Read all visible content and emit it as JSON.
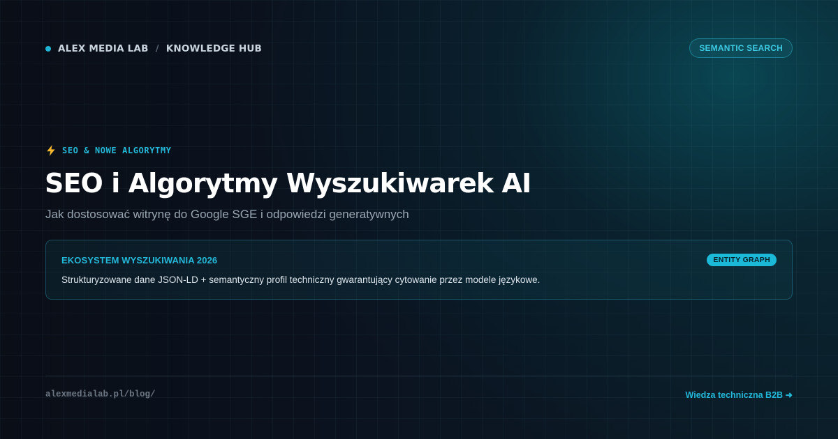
{
  "header": {
    "brand": "ALEX MEDIA LAB",
    "separator": "/",
    "section": "KNOWLEDGE HUB",
    "pill_label": "SEMANTIC SEARCH"
  },
  "hero": {
    "eyebrow": "SEO & NOWE ALGORYTMY",
    "title": "SEO i Algorytmy Wyszukiwarek AI",
    "subtitle": "Jak dostosować witrynę do Google SGE i odpowiedzi generatywnych"
  },
  "card": {
    "title": "EKOSYSTEM WYSZUKIWANIA 2026",
    "badge": "ENTITY GRAPH",
    "description": "Strukturyzowane dane JSON-LD + semantyczny profil techniczny gwarantujący cytowanie przez modele językowe."
  },
  "footer": {
    "url": "alexmedialab.pl/blog/",
    "link_label": "Wiedza techniczna B2B ➜"
  },
  "icons": {
    "brand_dot": "dot-icon",
    "eyebrow": "lightning-bolt-icon"
  },
  "colors": {
    "accent": "#23b8d8",
    "badge_bg": "#1cb8d8",
    "background": "#090d16",
    "bolt": "#f5b82e"
  }
}
